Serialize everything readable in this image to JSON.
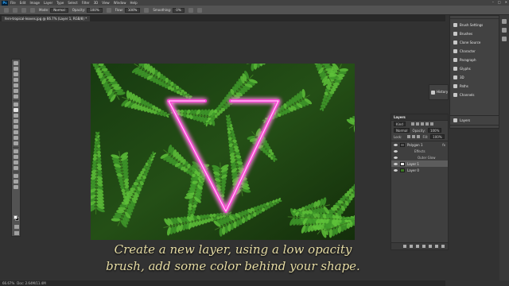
{
  "menubar": {
    "logo": "Ps",
    "items": [
      "File",
      "Edit",
      "Image",
      "Layer",
      "Type",
      "Select",
      "Filter",
      "3D",
      "View",
      "Window",
      "Help"
    ]
  },
  "options": {
    "mode_label": "Mode:",
    "mode_value": "Normal",
    "opacity_label": "Opacity:",
    "opacity_value": "100%",
    "flow_label": "Flow:",
    "flow_value": "100%",
    "smoothing_label": "Smoothing:",
    "smoothing_value": "0%"
  },
  "document": {
    "tab_title": "fern-tropical-leaves.jpg @ 66.7% (Layer 1, RGB/8) *"
  },
  "status": {
    "zoom": "66.67%",
    "info": "Doc: 2.64M/11.4M"
  },
  "caption": {
    "line1": "Create a new layer, using a low opacity",
    "line2": "brush, add some color behind your shape."
  },
  "history_panel": {
    "label": "History"
  },
  "right_dock": {
    "items": [
      "Brush Settings",
      "Brushes",
      "Clone Source",
      "Character",
      "Paragraph",
      "Glyphs",
      "3D",
      "Paths",
      "Channels"
    ],
    "layers_label": "Layers"
  },
  "layers_panel": {
    "tab": "Layers",
    "filter_label": "Kind",
    "blend_mode": "Normal",
    "opacity_label": "Opacity:",
    "opacity_value": "100%",
    "lock_label": "Lock:",
    "fill_label": "Fill:",
    "fill_value": "100%",
    "layers": [
      {
        "name": "Polygon 1",
        "type": "layer"
      },
      {
        "name": "Effects",
        "type": "sub"
      },
      {
        "name": "Outer Glow",
        "type": "sub2"
      },
      {
        "name": "Layer 1",
        "type": "layer",
        "selected": true
      },
      {
        "name": "Layer 0",
        "type": "layer"
      }
    ],
    "fx": "fx"
  },
  "colors": {
    "neon": "#ff3fd8",
    "caption": "#e6dca4",
    "fern_dark": "#1d3d12",
    "fern_light": "#5ec23a"
  }
}
